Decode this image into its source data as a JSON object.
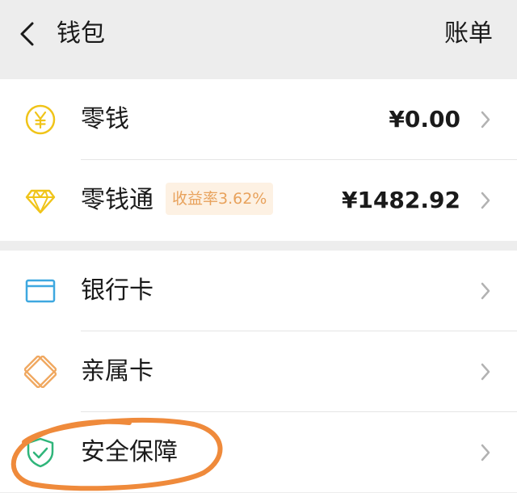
{
  "header": {
    "title": "钱包",
    "bill_label": "账单",
    "back_icon": "chevron-left-icon"
  },
  "wallet_items": [
    {
      "label": "零钱",
      "value": "¥0.00",
      "icon": "yuan-coin-icon"
    },
    {
      "label": "零钱通",
      "badge": "收益率3.62%",
      "value": "¥1482.92",
      "icon": "diamond-icon"
    }
  ],
  "card_items": [
    {
      "label": "银行卡",
      "icon": "bank-card-icon"
    },
    {
      "label": "亲属卡",
      "icon": "family-card-icon"
    },
    {
      "label": "安全保障",
      "icon": "shield-check-icon"
    }
  ],
  "colors": {
    "background": "#ededed",
    "gold_icon": "#f0c419",
    "blue_icon": "#3ea8e0",
    "orange_icon": "#f0a860",
    "green_icon": "#2fb57a",
    "badge_text": "#e8a25c",
    "badge_bg": "#fdf1e3",
    "annotation_stroke": "#ef8a3b"
  }
}
